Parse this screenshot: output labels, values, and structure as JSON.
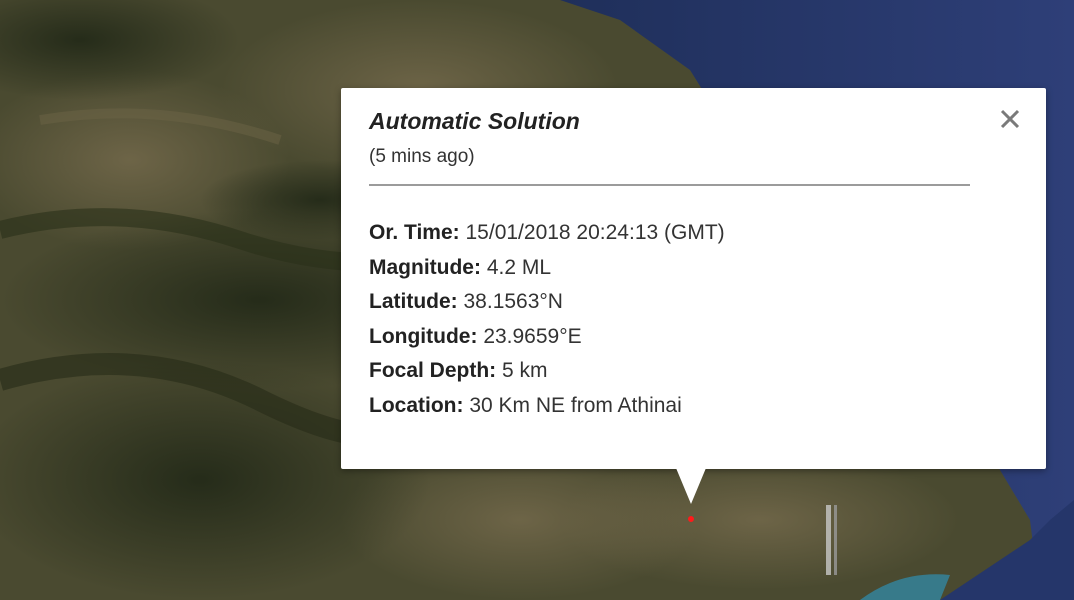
{
  "info_window": {
    "title": "Automatic Solution",
    "subtitle": "(5 mins ago)",
    "rows": [
      {
        "label": "Or. Time:",
        "value": "15/01/2018  20:24:13 (GMT)"
      },
      {
        "label": "Magnitude:",
        "value": "4.2 ML"
      },
      {
        "label": "Latitude:",
        "value": "38.1563°N"
      },
      {
        "label": "Longitude:",
        "value": "23.9659°E"
      },
      {
        "label": "Focal Depth:",
        "value": "5 km"
      },
      {
        "label": "Location:",
        "value": "30 Km NE from Athinai"
      }
    ],
    "close_icon": "close-icon"
  },
  "map": {
    "type": "satellite",
    "marker_color": "#ff1a1a"
  }
}
